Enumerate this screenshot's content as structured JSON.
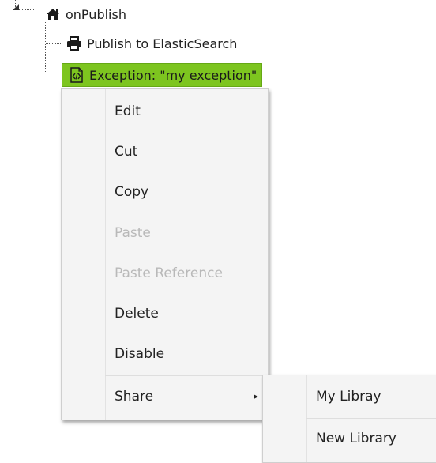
{
  "tree": {
    "root": {
      "label": "onPublish",
      "icon": "home-icon"
    },
    "children": [
      {
        "label": "Publish to ElasticSearch",
        "icon": "printer-icon"
      },
      {
        "label": "Exception: \"my exception\"",
        "icon": "code-file-icon",
        "selected": true,
        "selected_color": "#7dc51f"
      }
    ]
  },
  "context_menu": {
    "items": [
      {
        "label": "Edit",
        "enabled": true
      },
      {
        "label": "Cut",
        "enabled": true
      },
      {
        "label": "Copy",
        "enabled": true
      },
      {
        "label": "Paste",
        "enabled": false
      },
      {
        "label": "Paste Reference",
        "enabled": false
      },
      {
        "label": "Delete",
        "enabled": true
      },
      {
        "label": "Disable",
        "enabled": true
      },
      {
        "label": "Share",
        "enabled": true,
        "submenu_arrow": "▸"
      }
    ]
  },
  "share_submenu": {
    "items": [
      {
        "label": "My Libray"
      },
      {
        "label": "New Library"
      }
    ]
  }
}
